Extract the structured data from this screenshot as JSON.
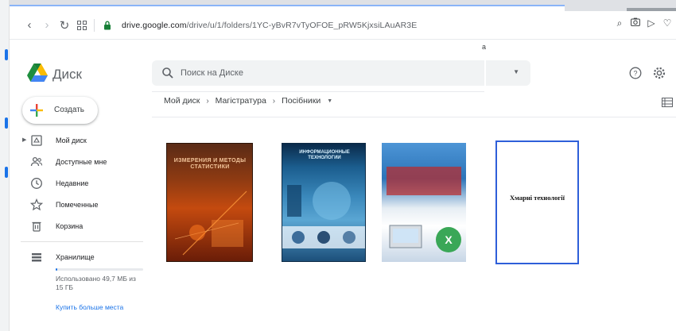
{
  "browser": {
    "url_host": "drive.google.com",
    "url_path": "/drive/u/1/folders/1YC-yBvR7vTyOFOE_pRW5KjxsiLAuAR3E",
    "bookmark_fragment": "a"
  },
  "app": {
    "title": "Диск"
  },
  "search": {
    "placeholder": "Поиск на Диске"
  },
  "sidebar": {
    "create_label": "Создать",
    "items": [
      {
        "label": "Мой диск",
        "icon": "drive-folder-icon"
      },
      {
        "label": "Доступные мне",
        "icon": "shared-people-icon"
      },
      {
        "label": "Недавние",
        "icon": "clock-icon"
      },
      {
        "label": "Помеченные",
        "icon": "star-icon"
      },
      {
        "label": "Корзина",
        "icon": "trash-icon"
      }
    ],
    "storage": {
      "label": "Хранилище",
      "usage": "Использовано 49,7 МБ из 15 ГБ",
      "used_fraction": 0.0033,
      "buy_link": "Купить больше места"
    }
  },
  "breadcrumb": [
    "Мой диск",
    "Магістратура",
    "Посібники"
  ],
  "files": [
    {
      "title_lines": "ИЗМЕРЕНИЯ И МЕТОДЫ СТАТИСТИКИ",
      "subtitle": ""
    },
    {
      "title_lines": "ИНФОРМАЦИОННЫЕ ТЕХНОЛОГИИ"
    },
    {
      "title_lines": ""
    },
    {
      "author": "",
      "title": "Хмарні технології",
      "footer": ""
    }
  ],
  "colors": {
    "accent": "#1a73e8",
    "selected_border": "#2e5fd9",
    "search_bg": "#f1f3f4"
  }
}
